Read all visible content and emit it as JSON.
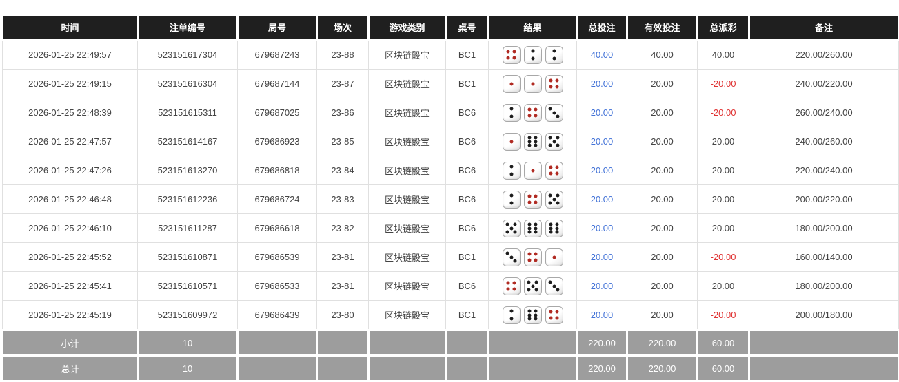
{
  "columns": {
    "time": "时间",
    "bet_id": "注单编号",
    "round_id": "局号",
    "session": "场次",
    "game_type": "游戏类别",
    "table_no": "桌号",
    "result": "结果",
    "total_bet": "总投注",
    "valid_bet": "有效投注",
    "payout": "总派彩",
    "remark": "备注"
  },
  "rows": [
    {
      "time": "2026-01-25 22:49:57",
      "bet_id": "523151617304",
      "round_id": "679687243",
      "session": "23-88",
      "game_type": "区块链骰宝",
      "table_no": "BC1",
      "dice": [
        4,
        2,
        2
      ],
      "total_bet": "40.00",
      "valid_bet": "40.00",
      "payout": "40.00",
      "remark": "220.00/260.00"
    },
    {
      "time": "2026-01-25 22:49:15",
      "bet_id": "523151616304",
      "round_id": "679687144",
      "session": "23-87",
      "game_type": "区块链骰宝",
      "table_no": "BC1",
      "dice": [
        1,
        1,
        4
      ],
      "total_bet": "20.00",
      "valid_bet": "20.00",
      "payout": "-20.00",
      "remark": "240.00/220.00"
    },
    {
      "time": "2026-01-25 22:48:39",
      "bet_id": "523151615311",
      "round_id": "679687025",
      "session": "23-86",
      "game_type": "区块链骰宝",
      "table_no": "BC6",
      "dice": [
        2,
        4,
        3
      ],
      "total_bet": "20.00",
      "valid_bet": "20.00",
      "payout": "-20.00",
      "remark": "260.00/240.00"
    },
    {
      "time": "2026-01-25 22:47:57",
      "bet_id": "523151614167",
      "round_id": "679686923",
      "session": "23-85",
      "game_type": "区块链骰宝",
      "table_no": "BC6",
      "dice": [
        1,
        6,
        5
      ],
      "total_bet": "20.00",
      "valid_bet": "20.00",
      "payout": "20.00",
      "remark": "240.00/260.00"
    },
    {
      "time": "2026-01-25 22:47:26",
      "bet_id": "523151613270",
      "round_id": "679686818",
      "session": "23-84",
      "game_type": "区块链骰宝",
      "table_no": "BC6",
      "dice": [
        2,
        1,
        4
      ],
      "total_bet": "20.00",
      "valid_bet": "20.00",
      "payout": "20.00",
      "remark": "220.00/240.00"
    },
    {
      "time": "2026-01-25 22:46:48",
      "bet_id": "523151612236",
      "round_id": "679686724",
      "session": "23-83",
      "game_type": "区块链骰宝",
      "table_no": "BC6",
      "dice": [
        2,
        4,
        5
      ],
      "total_bet": "20.00",
      "valid_bet": "20.00",
      "payout": "20.00",
      "remark": "200.00/220.00"
    },
    {
      "time": "2026-01-25 22:46:10",
      "bet_id": "523151611287",
      "round_id": "679686618",
      "session": "23-82",
      "game_type": "区块链骰宝",
      "table_no": "BC6",
      "dice": [
        5,
        6,
        6
      ],
      "total_bet": "20.00",
      "valid_bet": "20.00",
      "payout": "20.00",
      "remark": "180.00/200.00"
    },
    {
      "time": "2026-01-25 22:45:52",
      "bet_id": "523151610871",
      "round_id": "679686539",
      "session": "23-81",
      "game_type": "区块链骰宝",
      "table_no": "BC1",
      "dice": [
        3,
        4,
        1
      ],
      "total_bet": "20.00",
      "valid_bet": "20.00",
      "payout": "-20.00",
      "remark": "160.00/140.00"
    },
    {
      "time": "2026-01-25 22:45:41",
      "bet_id": "523151610571",
      "round_id": "679686533",
      "session": "23-81",
      "game_type": "区块链骰宝",
      "table_no": "BC6",
      "dice": [
        4,
        5,
        3
      ],
      "total_bet": "20.00",
      "valid_bet": "20.00",
      "payout": "20.00",
      "remark": "180.00/200.00"
    },
    {
      "time": "2026-01-25 22:45:19",
      "bet_id": "523151609972",
      "round_id": "679686439",
      "session": "23-80",
      "game_type": "区块链骰宝",
      "table_no": "BC1",
      "dice": [
        2,
        6,
        4
      ],
      "total_bet": "20.00",
      "valid_bet": "20.00",
      "payout": "-20.00",
      "remark": "200.00/180.00"
    }
  ],
  "footer": {
    "subtotal": {
      "label": "小计",
      "count": "10",
      "total_bet": "220.00",
      "valid_bet": "220.00",
      "payout": "60.00"
    },
    "total": {
      "label": "总计",
      "count": "10",
      "total_bet": "220.00",
      "valid_bet": "220.00",
      "payout": "60.00"
    }
  },
  "colors": {
    "header_bg": "#1f1f1f",
    "footer_bg": "#9d9d9d",
    "link_blue": "#4272d7",
    "negative_red": "#e03333",
    "dice_pip_red": "#b02a22",
    "dice_pip_black": "#1c1c1c"
  }
}
